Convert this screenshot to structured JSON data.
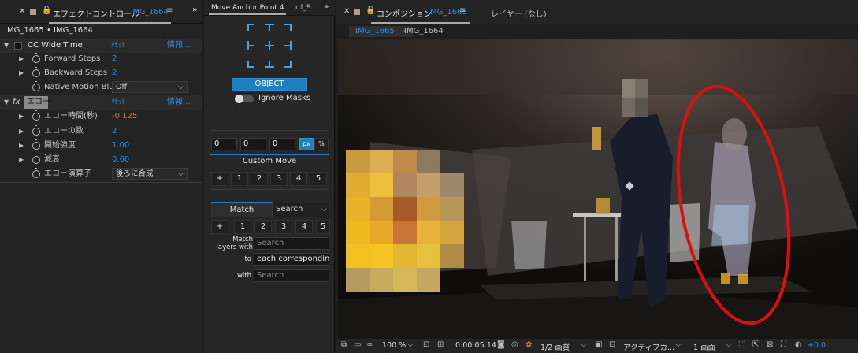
{
  "left_panel": {
    "tab_title": "エフェクトコントロール",
    "tab_layer": "IMG_1664",
    "breadcrumb": "IMG_1665 • IMG_1664",
    "effect1": {
      "name": "CC Wide Time",
      "reset": "ﾘｾｯﾄ",
      "info": "情報...",
      "params": [
        {
          "label": "Forward Steps",
          "value": "2"
        },
        {
          "label": "Backward Steps",
          "value": "2"
        },
        {
          "label": "Native Motion Blur",
          "value": "Off"
        }
      ]
    },
    "effect2": {
      "fx": "fx",
      "name": "エコー",
      "reset": "ﾘｾｯﾄ",
      "info": "情報...",
      "params": [
        {
          "label": "エコー時間(秒)",
          "value": "-0.125"
        },
        {
          "label": "エコーの数",
          "value": "2"
        },
        {
          "label": "開始強度",
          "value": "1.00"
        },
        {
          "label": "減衰",
          "value": "0.60"
        },
        {
          "label": "エコー演算子",
          "value": "後ろに合成"
        }
      ]
    }
  },
  "mid_panel": {
    "tab1": "Move Anchor Point 4",
    "tab2": "rd_S",
    "object_button": "OBJECT",
    "ignore_masks": "Ignore Masks",
    "xyz": [
      "0",
      "0",
      "0"
    ],
    "px": "px",
    "pct": "%",
    "custom_move": "Custom Move",
    "num_buttons": [
      "+",
      "1",
      "2",
      "3",
      "4",
      "5"
    ],
    "match_tab": "Match",
    "search_tab": "Search",
    "match_layers_label": "Match layers with",
    "search_placeholder": "Search",
    "to_label": "to",
    "to_value": "each corresponding la",
    "with_label": "with",
    "with_placeholder": "Search"
  },
  "right_panel": {
    "comp_title": "コンポジション",
    "comp_name": "IMG_1665",
    "layer_tab": "レイヤー (なし)",
    "flow_active": "IMG_1665",
    "flow_next": "IMG_1664",
    "footer": {
      "zoom": "100 %",
      "timecode": "0:00:05:14",
      "resolution": "1/2 画質",
      "camera": "アクティブカ...",
      "views": "1 画面",
      "exposure": "+0.0"
    }
  },
  "colors": {
    "accent_blue": "#2d8ceb",
    "object_btn": "#1f7fbf",
    "red_ellipse": "#d81010"
  }
}
